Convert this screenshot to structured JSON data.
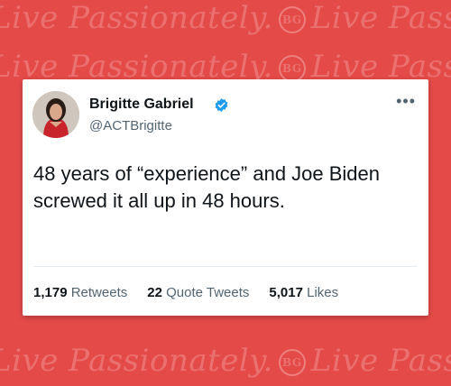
{
  "background": {
    "watermark_text": "Live Passionately.",
    "watermark_seal": "BG",
    "color": "#e44a48"
  },
  "tweet": {
    "author_name": "Brigitte Gabriel",
    "author_handle": "@ACTBrigitte",
    "verified": true,
    "more_icon": "more-horizontal-icon",
    "text": "48 years of “experience” and Joe Biden screwed it all up in 48 hours.",
    "stats": {
      "retweets_count": "1,179",
      "retweets_label": "Retweets",
      "quote_tweets_count": "22",
      "quote_tweets_label": "Quote Tweets",
      "likes_count": "5,017",
      "likes_label": "Likes"
    }
  },
  "colors": {
    "verified_badge": "#1d9bf0",
    "text_primary": "#0f1419",
    "text_secondary": "#536471"
  }
}
